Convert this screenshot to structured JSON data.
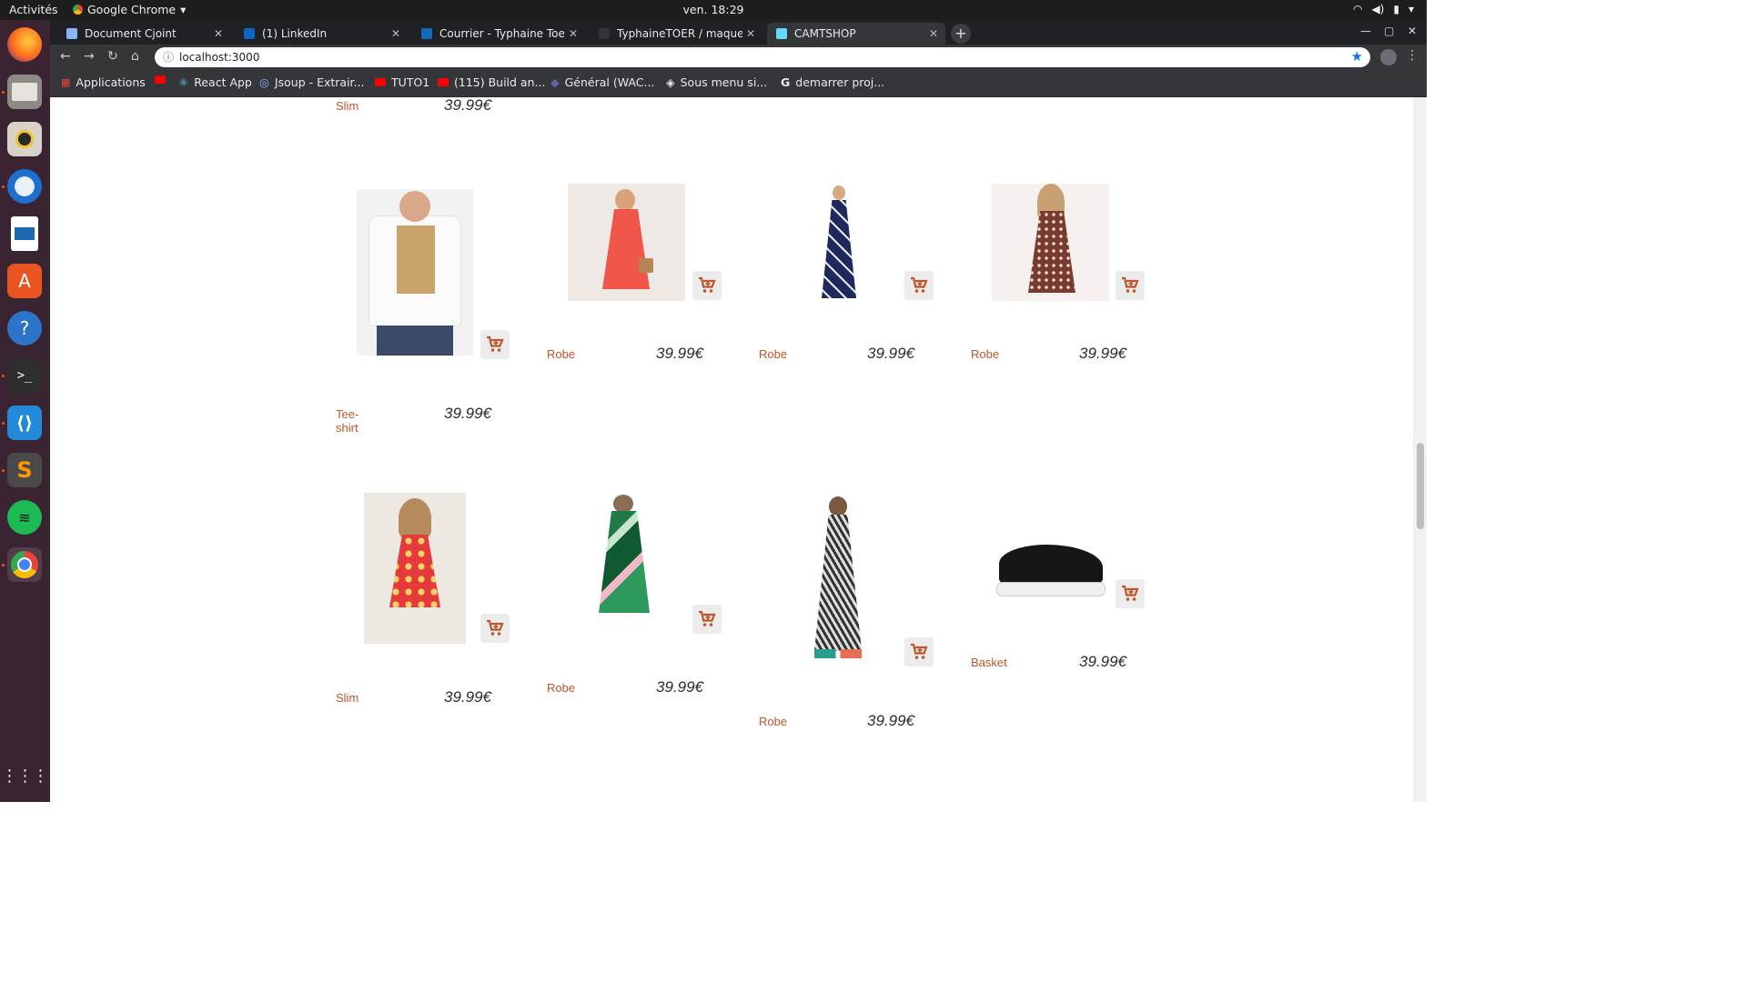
{
  "system": {
    "activities": "Activités",
    "app_name": "Google Chrome",
    "clock": "ven. 18:29"
  },
  "browser": {
    "tabs": [
      {
        "title": "Document Cjoint",
        "color": "#8ab4f8"
      },
      {
        "title": "(1) LinkedIn",
        "color": "#0a66c2"
      },
      {
        "title": "Courrier - Typhaine Toer -",
        "color": "#0f6cbd"
      },
      {
        "title": "TyphaineTOER / maquett",
        "color": "#333333"
      },
      {
        "title": "CAMTSHOP",
        "color": "#61dafb"
      }
    ],
    "url": "localhost:3000",
    "bookmarks": [
      {
        "label": "Applications",
        "color": "#e94235"
      },
      {
        "label": "",
        "color": "#ff0000"
      },
      {
        "label": "React App",
        "color": "#61dafb"
      },
      {
        "label": "Jsoup - Extrair...",
        "color": "#8ab4f8"
      },
      {
        "label": "TUTO1",
        "color": "#ff0000"
      },
      {
        "label": "(115) Build an...",
        "color": "#ff0000"
      },
      {
        "label": "Général (WAC...",
        "color": "#6264a7"
      },
      {
        "label": "Sous menu si...",
        "color": "#ffffff"
      },
      {
        "label": "demarrer proj...",
        "color": "#ffffff"
      }
    ]
  },
  "shop": {
    "accent": "#c0552c",
    "products": [
      {
        "name": "Slim",
        "price": "39.99€",
        "image": "partial-top"
      },
      {
        "name": "Tee-shirt",
        "price": "39.99€",
        "image": "white-tshirt"
      },
      {
        "name": "Robe",
        "price": "39.99€",
        "image": "coral-dress"
      },
      {
        "name": "Robe",
        "price": "39.99€",
        "image": "floral-maxi-dress"
      },
      {
        "name": "Robe",
        "price": "39.99€",
        "image": "polka-dot-dress"
      },
      {
        "name": "Slim",
        "price": "39.99€",
        "image": "red-floral-dress"
      },
      {
        "name": "Robe",
        "price": "39.99€",
        "image": "green-print-dress"
      },
      {
        "name": "Robe",
        "price": "39.99€",
        "image": "patterned-jumpsuit"
      },
      {
        "name": "Basket",
        "price": "39.99€",
        "image": "black-sneaker"
      }
    ]
  }
}
